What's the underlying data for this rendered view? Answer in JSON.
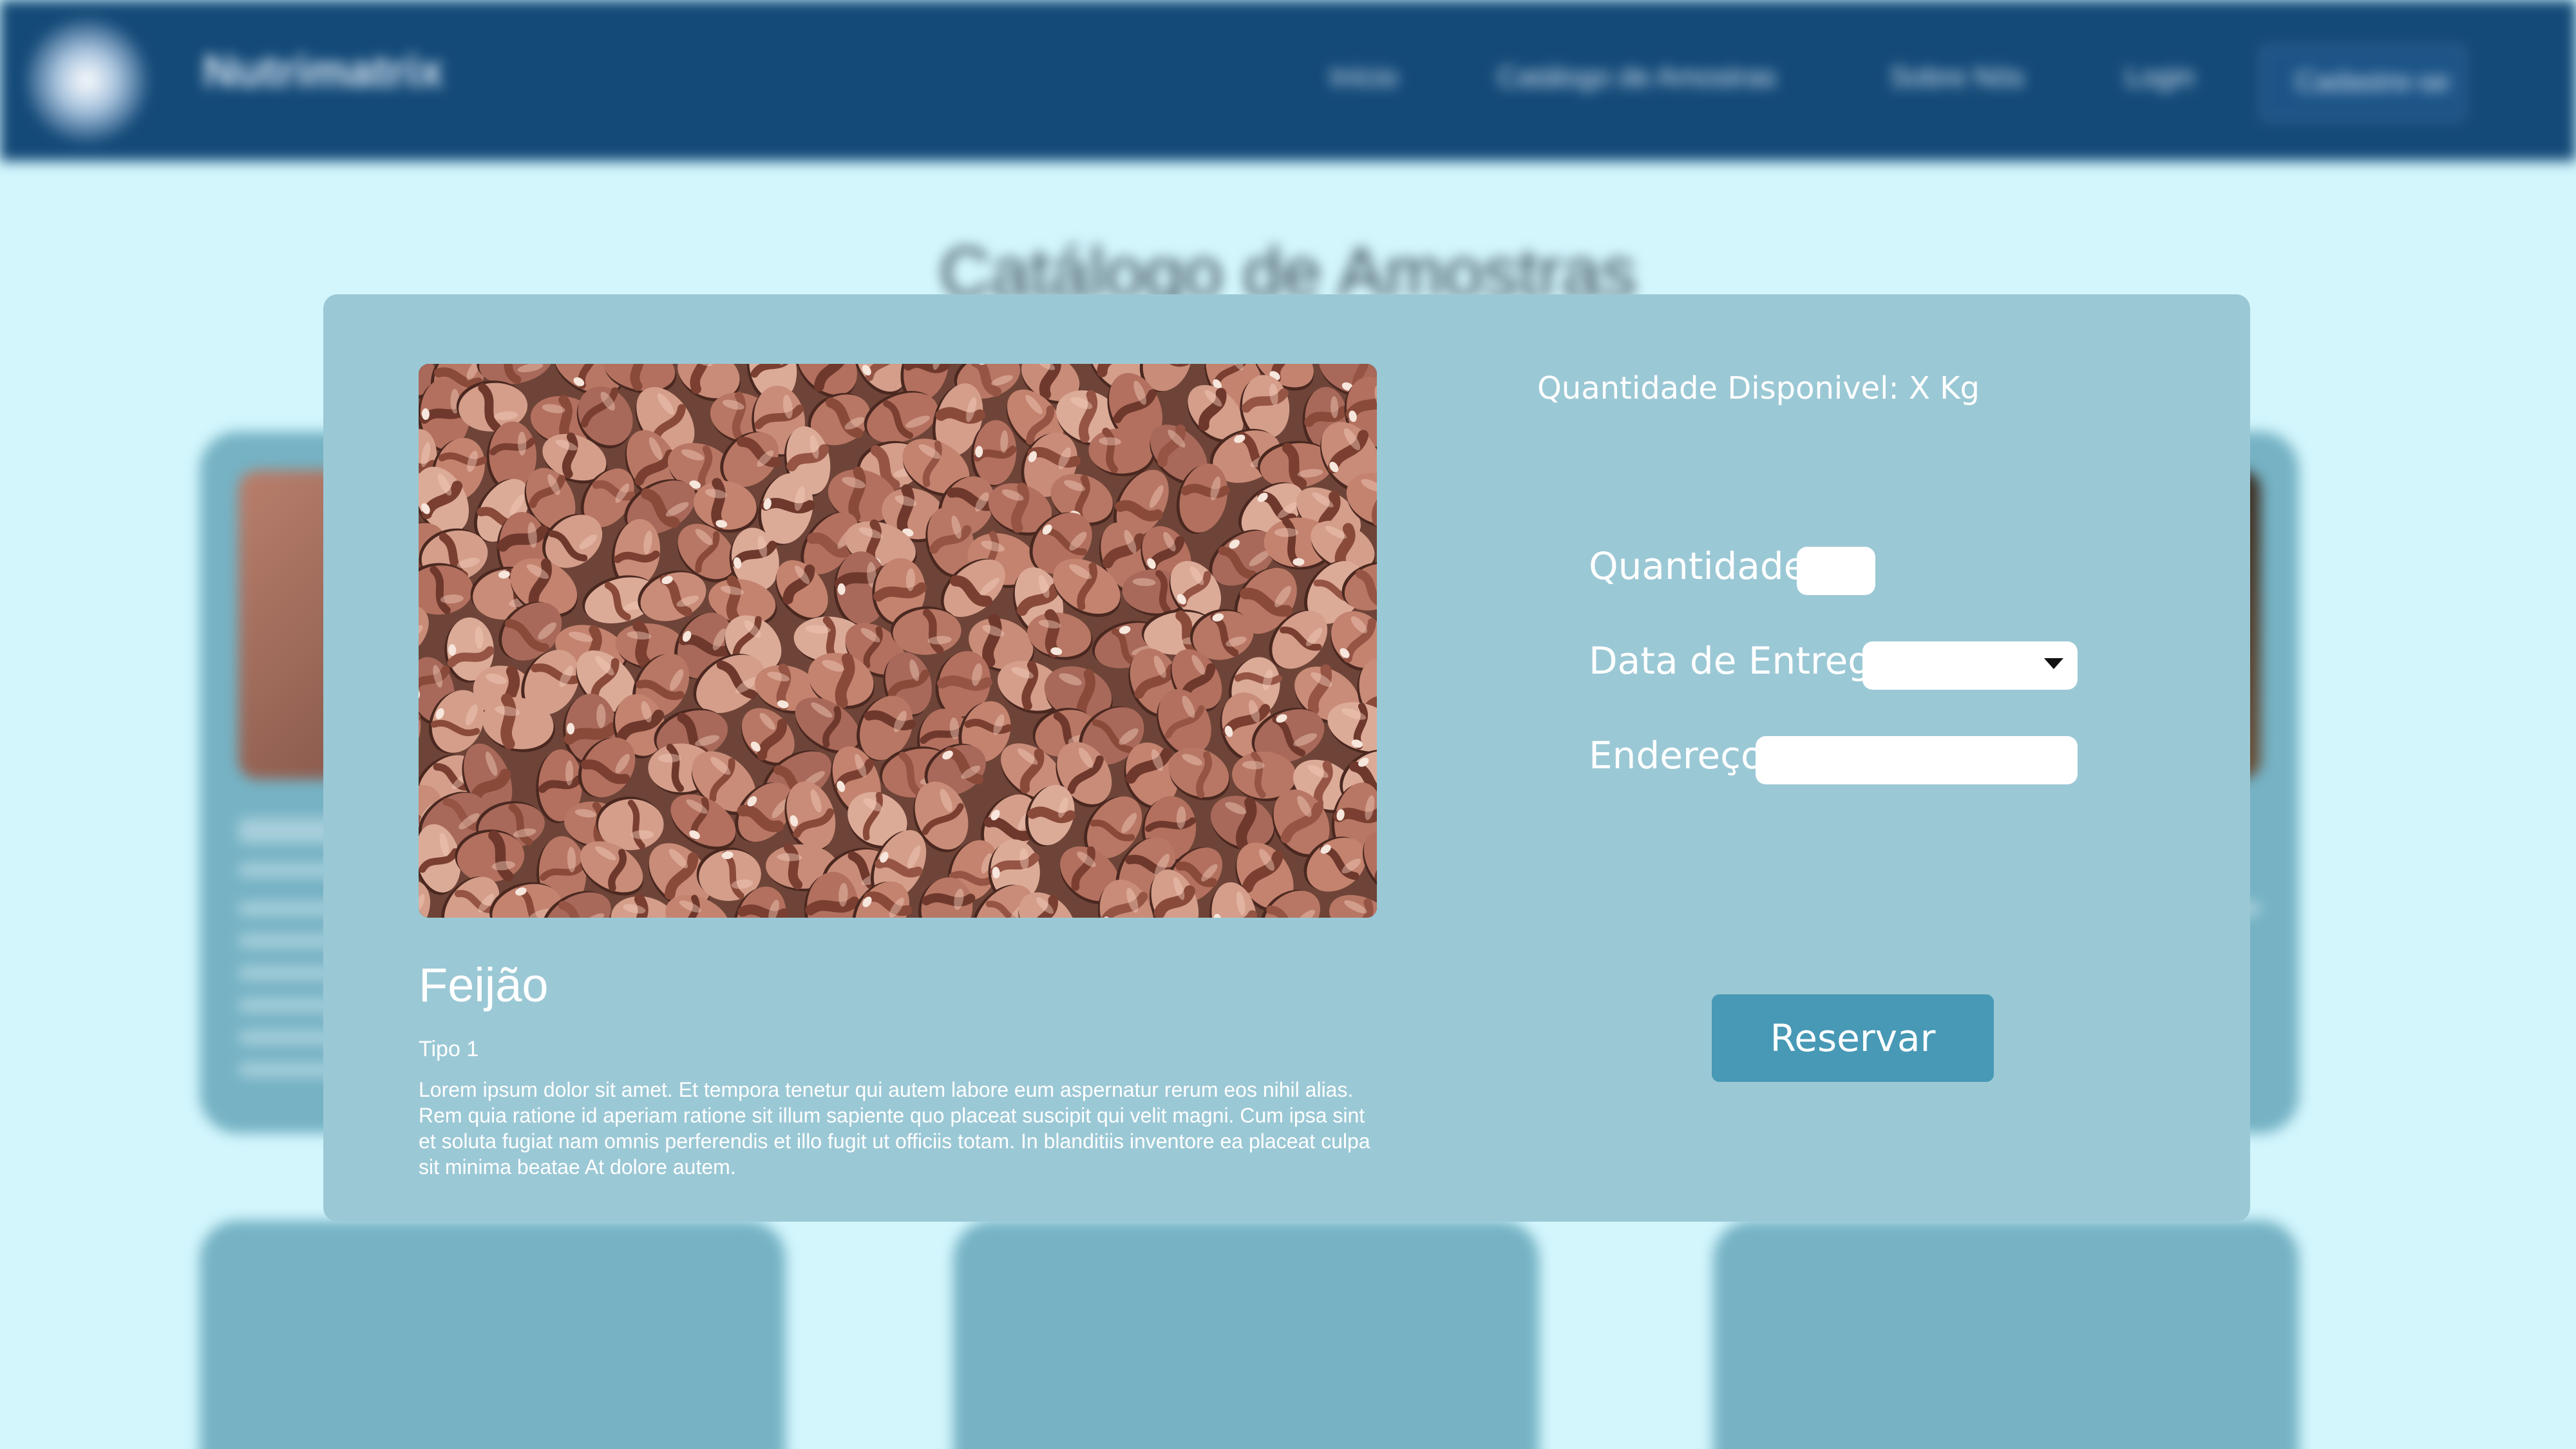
{
  "header": {
    "brand": "Nutrimatrix",
    "nav": [
      "Início",
      "Catálogo de Amostras",
      "Sobre Nós",
      "Login"
    ],
    "signup_label": "Cadastre-se"
  },
  "page_title": "Catálogo de Amostras",
  "modal": {
    "product": {
      "name": "Feijão",
      "type": "Tipo 1",
      "description": "Lorem ipsum dolor sit amet. Et tempora tenetur qui autem labore eum aspernatur rerum eos nihil alias. Rem quia ratione id aperiam ratione sit illum sapiente quo placeat suscipit qui velit magni. Cum ipsa sint et soluta fugiat nam omnis perferendis et illo fugit ut officiis totam. In blanditiis inventore ea placeat culpa sit minima beatae At dolore autem."
    },
    "available_text": "Quantidade Disponivel: X Kg",
    "form": {
      "quantity_label": "Quantidade",
      "quantity_value": "",
      "delivery_label": "Data de Entrega",
      "delivery_value": "",
      "address_label": "Endereço",
      "address_value": ""
    },
    "reserve_label": "Reservar"
  },
  "colors": {
    "page_bg": "#d3f6fd",
    "header_bg": "#144a78",
    "modal_bg": "#9bc8d5",
    "card_bg": "#75b2c4",
    "button_bg": "#4799b5"
  },
  "icons": {
    "select_arrow": "chevron-down-icon",
    "logo": "logo-icon"
  }
}
